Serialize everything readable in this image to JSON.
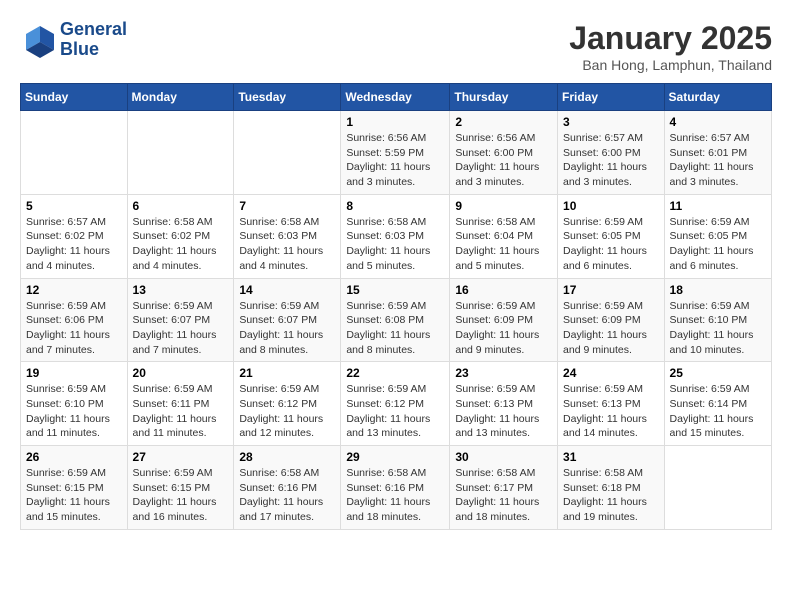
{
  "header": {
    "logo_line1": "General",
    "logo_line2": "Blue",
    "title": "January 2025",
    "subtitle": "Ban Hong, Lamphun, Thailand"
  },
  "weekdays": [
    "Sunday",
    "Monday",
    "Tuesday",
    "Wednesday",
    "Thursday",
    "Friday",
    "Saturday"
  ],
  "weeks": [
    [
      {
        "day": "",
        "sunrise": "",
        "sunset": "",
        "daylight": ""
      },
      {
        "day": "",
        "sunrise": "",
        "sunset": "",
        "daylight": ""
      },
      {
        "day": "",
        "sunrise": "",
        "sunset": "",
        "daylight": ""
      },
      {
        "day": "1",
        "sunrise": "Sunrise: 6:56 AM",
        "sunset": "Sunset: 5:59 PM",
        "daylight": "Daylight: 11 hours and 3 minutes."
      },
      {
        "day": "2",
        "sunrise": "Sunrise: 6:56 AM",
        "sunset": "Sunset: 6:00 PM",
        "daylight": "Daylight: 11 hours and 3 minutes."
      },
      {
        "day": "3",
        "sunrise": "Sunrise: 6:57 AM",
        "sunset": "Sunset: 6:00 PM",
        "daylight": "Daylight: 11 hours and 3 minutes."
      },
      {
        "day": "4",
        "sunrise": "Sunrise: 6:57 AM",
        "sunset": "Sunset: 6:01 PM",
        "daylight": "Daylight: 11 hours and 3 minutes."
      }
    ],
    [
      {
        "day": "5",
        "sunrise": "Sunrise: 6:57 AM",
        "sunset": "Sunset: 6:02 PM",
        "daylight": "Daylight: 11 hours and 4 minutes."
      },
      {
        "day": "6",
        "sunrise": "Sunrise: 6:58 AM",
        "sunset": "Sunset: 6:02 PM",
        "daylight": "Daylight: 11 hours and 4 minutes."
      },
      {
        "day": "7",
        "sunrise": "Sunrise: 6:58 AM",
        "sunset": "Sunset: 6:03 PM",
        "daylight": "Daylight: 11 hours and 4 minutes."
      },
      {
        "day": "8",
        "sunrise": "Sunrise: 6:58 AM",
        "sunset": "Sunset: 6:03 PM",
        "daylight": "Daylight: 11 hours and 5 minutes."
      },
      {
        "day": "9",
        "sunrise": "Sunrise: 6:58 AM",
        "sunset": "Sunset: 6:04 PM",
        "daylight": "Daylight: 11 hours and 5 minutes."
      },
      {
        "day": "10",
        "sunrise": "Sunrise: 6:59 AM",
        "sunset": "Sunset: 6:05 PM",
        "daylight": "Daylight: 11 hours and 6 minutes."
      },
      {
        "day": "11",
        "sunrise": "Sunrise: 6:59 AM",
        "sunset": "Sunset: 6:05 PM",
        "daylight": "Daylight: 11 hours and 6 minutes."
      }
    ],
    [
      {
        "day": "12",
        "sunrise": "Sunrise: 6:59 AM",
        "sunset": "Sunset: 6:06 PM",
        "daylight": "Daylight: 11 hours and 7 minutes."
      },
      {
        "day": "13",
        "sunrise": "Sunrise: 6:59 AM",
        "sunset": "Sunset: 6:07 PM",
        "daylight": "Daylight: 11 hours and 7 minutes."
      },
      {
        "day": "14",
        "sunrise": "Sunrise: 6:59 AM",
        "sunset": "Sunset: 6:07 PM",
        "daylight": "Daylight: 11 hours and 8 minutes."
      },
      {
        "day": "15",
        "sunrise": "Sunrise: 6:59 AM",
        "sunset": "Sunset: 6:08 PM",
        "daylight": "Daylight: 11 hours and 8 minutes."
      },
      {
        "day": "16",
        "sunrise": "Sunrise: 6:59 AM",
        "sunset": "Sunset: 6:09 PM",
        "daylight": "Daylight: 11 hours and 9 minutes."
      },
      {
        "day": "17",
        "sunrise": "Sunrise: 6:59 AM",
        "sunset": "Sunset: 6:09 PM",
        "daylight": "Daylight: 11 hours and 9 minutes."
      },
      {
        "day": "18",
        "sunrise": "Sunrise: 6:59 AM",
        "sunset": "Sunset: 6:10 PM",
        "daylight": "Daylight: 11 hours and 10 minutes."
      }
    ],
    [
      {
        "day": "19",
        "sunrise": "Sunrise: 6:59 AM",
        "sunset": "Sunset: 6:10 PM",
        "daylight": "Daylight: 11 hours and 11 minutes."
      },
      {
        "day": "20",
        "sunrise": "Sunrise: 6:59 AM",
        "sunset": "Sunset: 6:11 PM",
        "daylight": "Daylight: 11 hours and 11 minutes."
      },
      {
        "day": "21",
        "sunrise": "Sunrise: 6:59 AM",
        "sunset": "Sunset: 6:12 PM",
        "daylight": "Daylight: 11 hours and 12 minutes."
      },
      {
        "day": "22",
        "sunrise": "Sunrise: 6:59 AM",
        "sunset": "Sunset: 6:12 PM",
        "daylight": "Daylight: 11 hours and 13 minutes."
      },
      {
        "day": "23",
        "sunrise": "Sunrise: 6:59 AM",
        "sunset": "Sunset: 6:13 PM",
        "daylight": "Daylight: 11 hours and 13 minutes."
      },
      {
        "day": "24",
        "sunrise": "Sunrise: 6:59 AM",
        "sunset": "Sunset: 6:13 PM",
        "daylight": "Daylight: 11 hours and 14 minutes."
      },
      {
        "day": "25",
        "sunrise": "Sunrise: 6:59 AM",
        "sunset": "Sunset: 6:14 PM",
        "daylight": "Daylight: 11 hours and 15 minutes."
      }
    ],
    [
      {
        "day": "26",
        "sunrise": "Sunrise: 6:59 AM",
        "sunset": "Sunset: 6:15 PM",
        "daylight": "Daylight: 11 hours and 15 minutes."
      },
      {
        "day": "27",
        "sunrise": "Sunrise: 6:59 AM",
        "sunset": "Sunset: 6:15 PM",
        "daylight": "Daylight: 11 hours and 16 minutes."
      },
      {
        "day": "28",
        "sunrise": "Sunrise: 6:58 AM",
        "sunset": "Sunset: 6:16 PM",
        "daylight": "Daylight: 11 hours and 17 minutes."
      },
      {
        "day": "29",
        "sunrise": "Sunrise: 6:58 AM",
        "sunset": "Sunset: 6:16 PM",
        "daylight": "Daylight: 11 hours and 18 minutes."
      },
      {
        "day": "30",
        "sunrise": "Sunrise: 6:58 AM",
        "sunset": "Sunset: 6:17 PM",
        "daylight": "Daylight: 11 hours and 18 minutes."
      },
      {
        "day": "31",
        "sunrise": "Sunrise: 6:58 AM",
        "sunset": "Sunset: 6:18 PM",
        "daylight": "Daylight: 11 hours and 19 minutes."
      },
      {
        "day": "",
        "sunrise": "",
        "sunset": "",
        "daylight": ""
      }
    ]
  ]
}
